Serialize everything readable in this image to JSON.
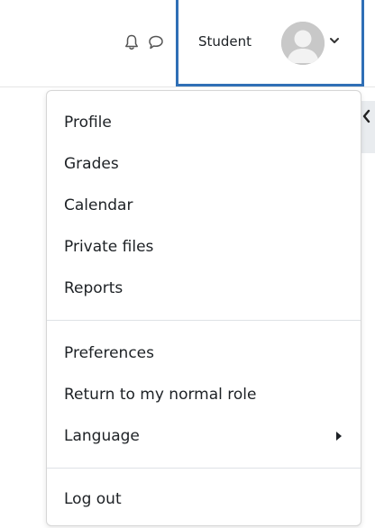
{
  "navbar": {
    "icons": {
      "notifications": "bell-icon",
      "messages": "chat-bubble-icon"
    }
  },
  "user_menu": {
    "name": "Student",
    "avatar": "default-user-avatar",
    "focus_color": "#2f6fb6"
  },
  "dropdown": {
    "groups": [
      {
        "items": [
          {
            "label": "Profile"
          },
          {
            "label": "Grades"
          },
          {
            "label": "Calendar"
          },
          {
            "label": "Private files"
          },
          {
            "label": "Reports"
          }
        ]
      },
      {
        "items": [
          {
            "label": "Preferences"
          },
          {
            "label": "Return to my normal role"
          },
          {
            "label": "Language",
            "has_submenu": true
          }
        ]
      },
      {
        "items": [
          {
            "label": "Log out"
          }
        ]
      }
    ]
  }
}
